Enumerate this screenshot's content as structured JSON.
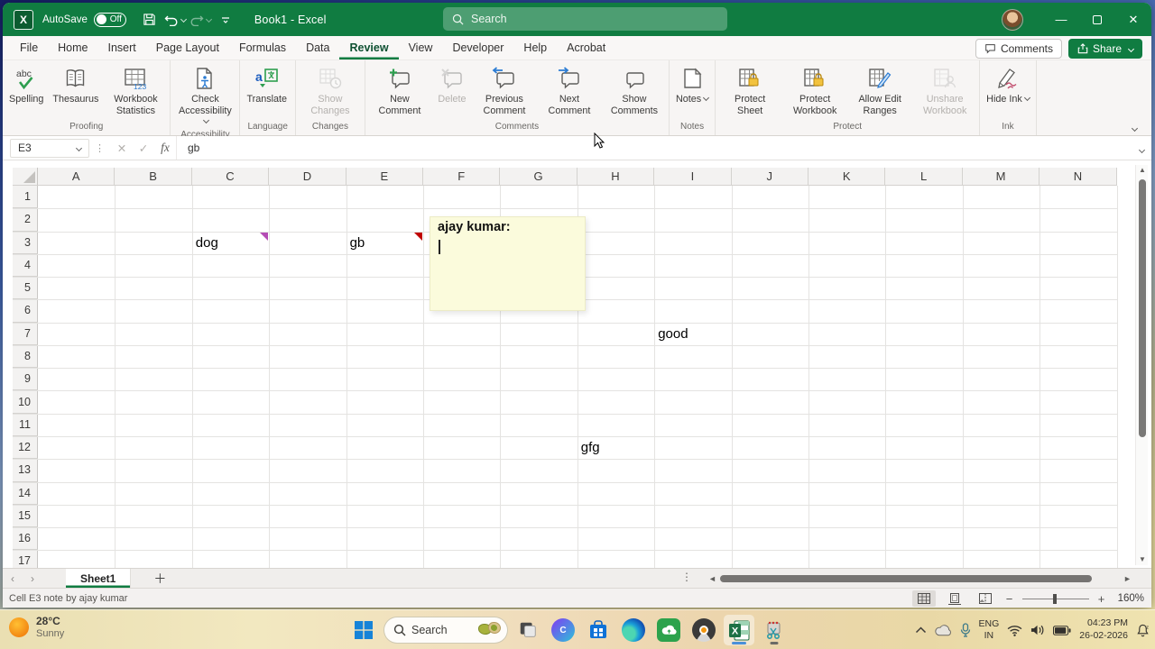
{
  "colors": {
    "accent_green": "#107C41",
    "note_bg": "#FBFBDC",
    "note_indicator_red": "#C00000",
    "comment_indicator_purple": "#B44CB4"
  },
  "title_bar": {
    "autosave_label": "AutoSave",
    "autosave_state": "Off",
    "title": "Book1 - Excel",
    "search_placeholder": "Search"
  },
  "ribbon": {
    "tabs": [
      {
        "label": "File"
      },
      {
        "label": "Home"
      },
      {
        "label": "Insert"
      },
      {
        "label": "Page Layout"
      },
      {
        "label": "Formulas"
      },
      {
        "label": "Data"
      },
      {
        "label": "Review",
        "active": true
      },
      {
        "label": "View"
      },
      {
        "label": "Developer"
      },
      {
        "label": "Help"
      },
      {
        "label": "Acrobat"
      }
    ],
    "comments_label": "Comments",
    "share_label": "Share",
    "groups": [
      {
        "name": "Proofing",
        "buttons": [
          {
            "label": "Spelling",
            "icon": "spelling"
          },
          {
            "label": "Thesaurus",
            "icon": "thesaurus"
          },
          {
            "label": "Workbook Statistics",
            "icon": "workbook-statistics"
          }
        ]
      },
      {
        "name": "Accessibility",
        "buttons": [
          {
            "label": "Check Accessibility",
            "icon": "check-accessibility",
            "dropdown": true
          }
        ]
      },
      {
        "name": "Language",
        "buttons": [
          {
            "label": "Translate",
            "icon": "translate"
          }
        ]
      },
      {
        "name": "Changes",
        "buttons": [
          {
            "label": "Show Changes",
            "icon": "show-changes",
            "disabled": true
          }
        ]
      },
      {
        "name": "Comments",
        "buttons": [
          {
            "label": "New Comment",
            "icon": "new-comment"
          },
          {
            "label": "Delete",
            "icon": "delete-comment",
            "disabled": true
          },
          {
            "label": "Previous Comment",
            "icon": "previous-comment"
          },
          {
            "label": "Next Comment",
            "icon": "next-comment"
          },
          {
            "label": "Show Comments",
            "icon": "show-comments"
          }
        ]
      },
      {
        "name": "Notes",
        "buttons": [
          {
            "label": "Notes",
            "icon": "notes",
            "dropdown": true
          }
        ]
      },
      {
        "name": "Protect",
        "buttons": [
          {
            "label": "Protect Sheet",
            "icon": "protect-sheet"
          },
          {
            "label": "Protect Workbook",
            "icon": "protect-workbook"
          },
          {
            "label": "Allow Edit Ranges",
            "icon": "allow-edit-ranges"
          },
          {
            "label": "Unshare Workbook",
            "icon": "unshare-workbook",
            "disabled": true
          }
        ]
      },
      {
        "name": "Ink",
        "buttons": [
          {
            "label": "Hide Ink",
            "icon": "hide-ink",
            "dropdown": true
          }
        ]
      }
    ]
  },
  "formula_bar": {
    "name_box": "E3",
    "value": "gb"
  },
  "sheet": {
    "columns": [
      "A",
      "B",
      "C",
      "D",
      "E",
      "F",
      "G",
      "H",
      "I",
      "J",
      "K",
      "L",
      "M",
      "N"
    ],
    "rows": [
      "1",
      "2",
      "3",
      "4",
      "5",
      "6",
      "7",
      "8",
      "9",
      "10",
      "11",
      "12",
      "13",
      "14",
      "15",
      "16",
      "17"
    ],
    "cells": [
      {
        "ref": "C3",
        "text": "dog",
        "indicator": "#B44CB4"
      },
      {
        "ref": "E3",
        "text": "gb",
        "indicator": "#C00000"
      },
      {
        "ref": "I7",
        "text": "good"
      },
      {
        "ref": "H12",
        "text": "gfg"
      }
    ],
    "note": {
      "author": "ajay kumar:"
    }
  },
  "tab_bar": {
    "sheets": [
      {
        "label": "Sheet1",
        "active": true
      }
    ]
  },
  "status_bar": {
    "message": "Cell E3 note by ajay kumar",
    "zoom_level": "160%"
  },
  "taskbar": {
    "weather": {
      "temp": "28°C",
      "condition": "Sunny"
    },
    "search_placeholder": "Search",
    "app_icons": [
      "start",
      "search",
      "task-view",
      "canva",
      "microsoft-store",
      "edge",
      "cloud-app",
      "media-player",
      "excel",
      "snipping-tool"
    ],
    "tray": {
      "language_line1": "ENG",
      "language_line2": "IN",
      "time": "04:23 PM",
      "date": "26-02-2026"
    }
  }
}
